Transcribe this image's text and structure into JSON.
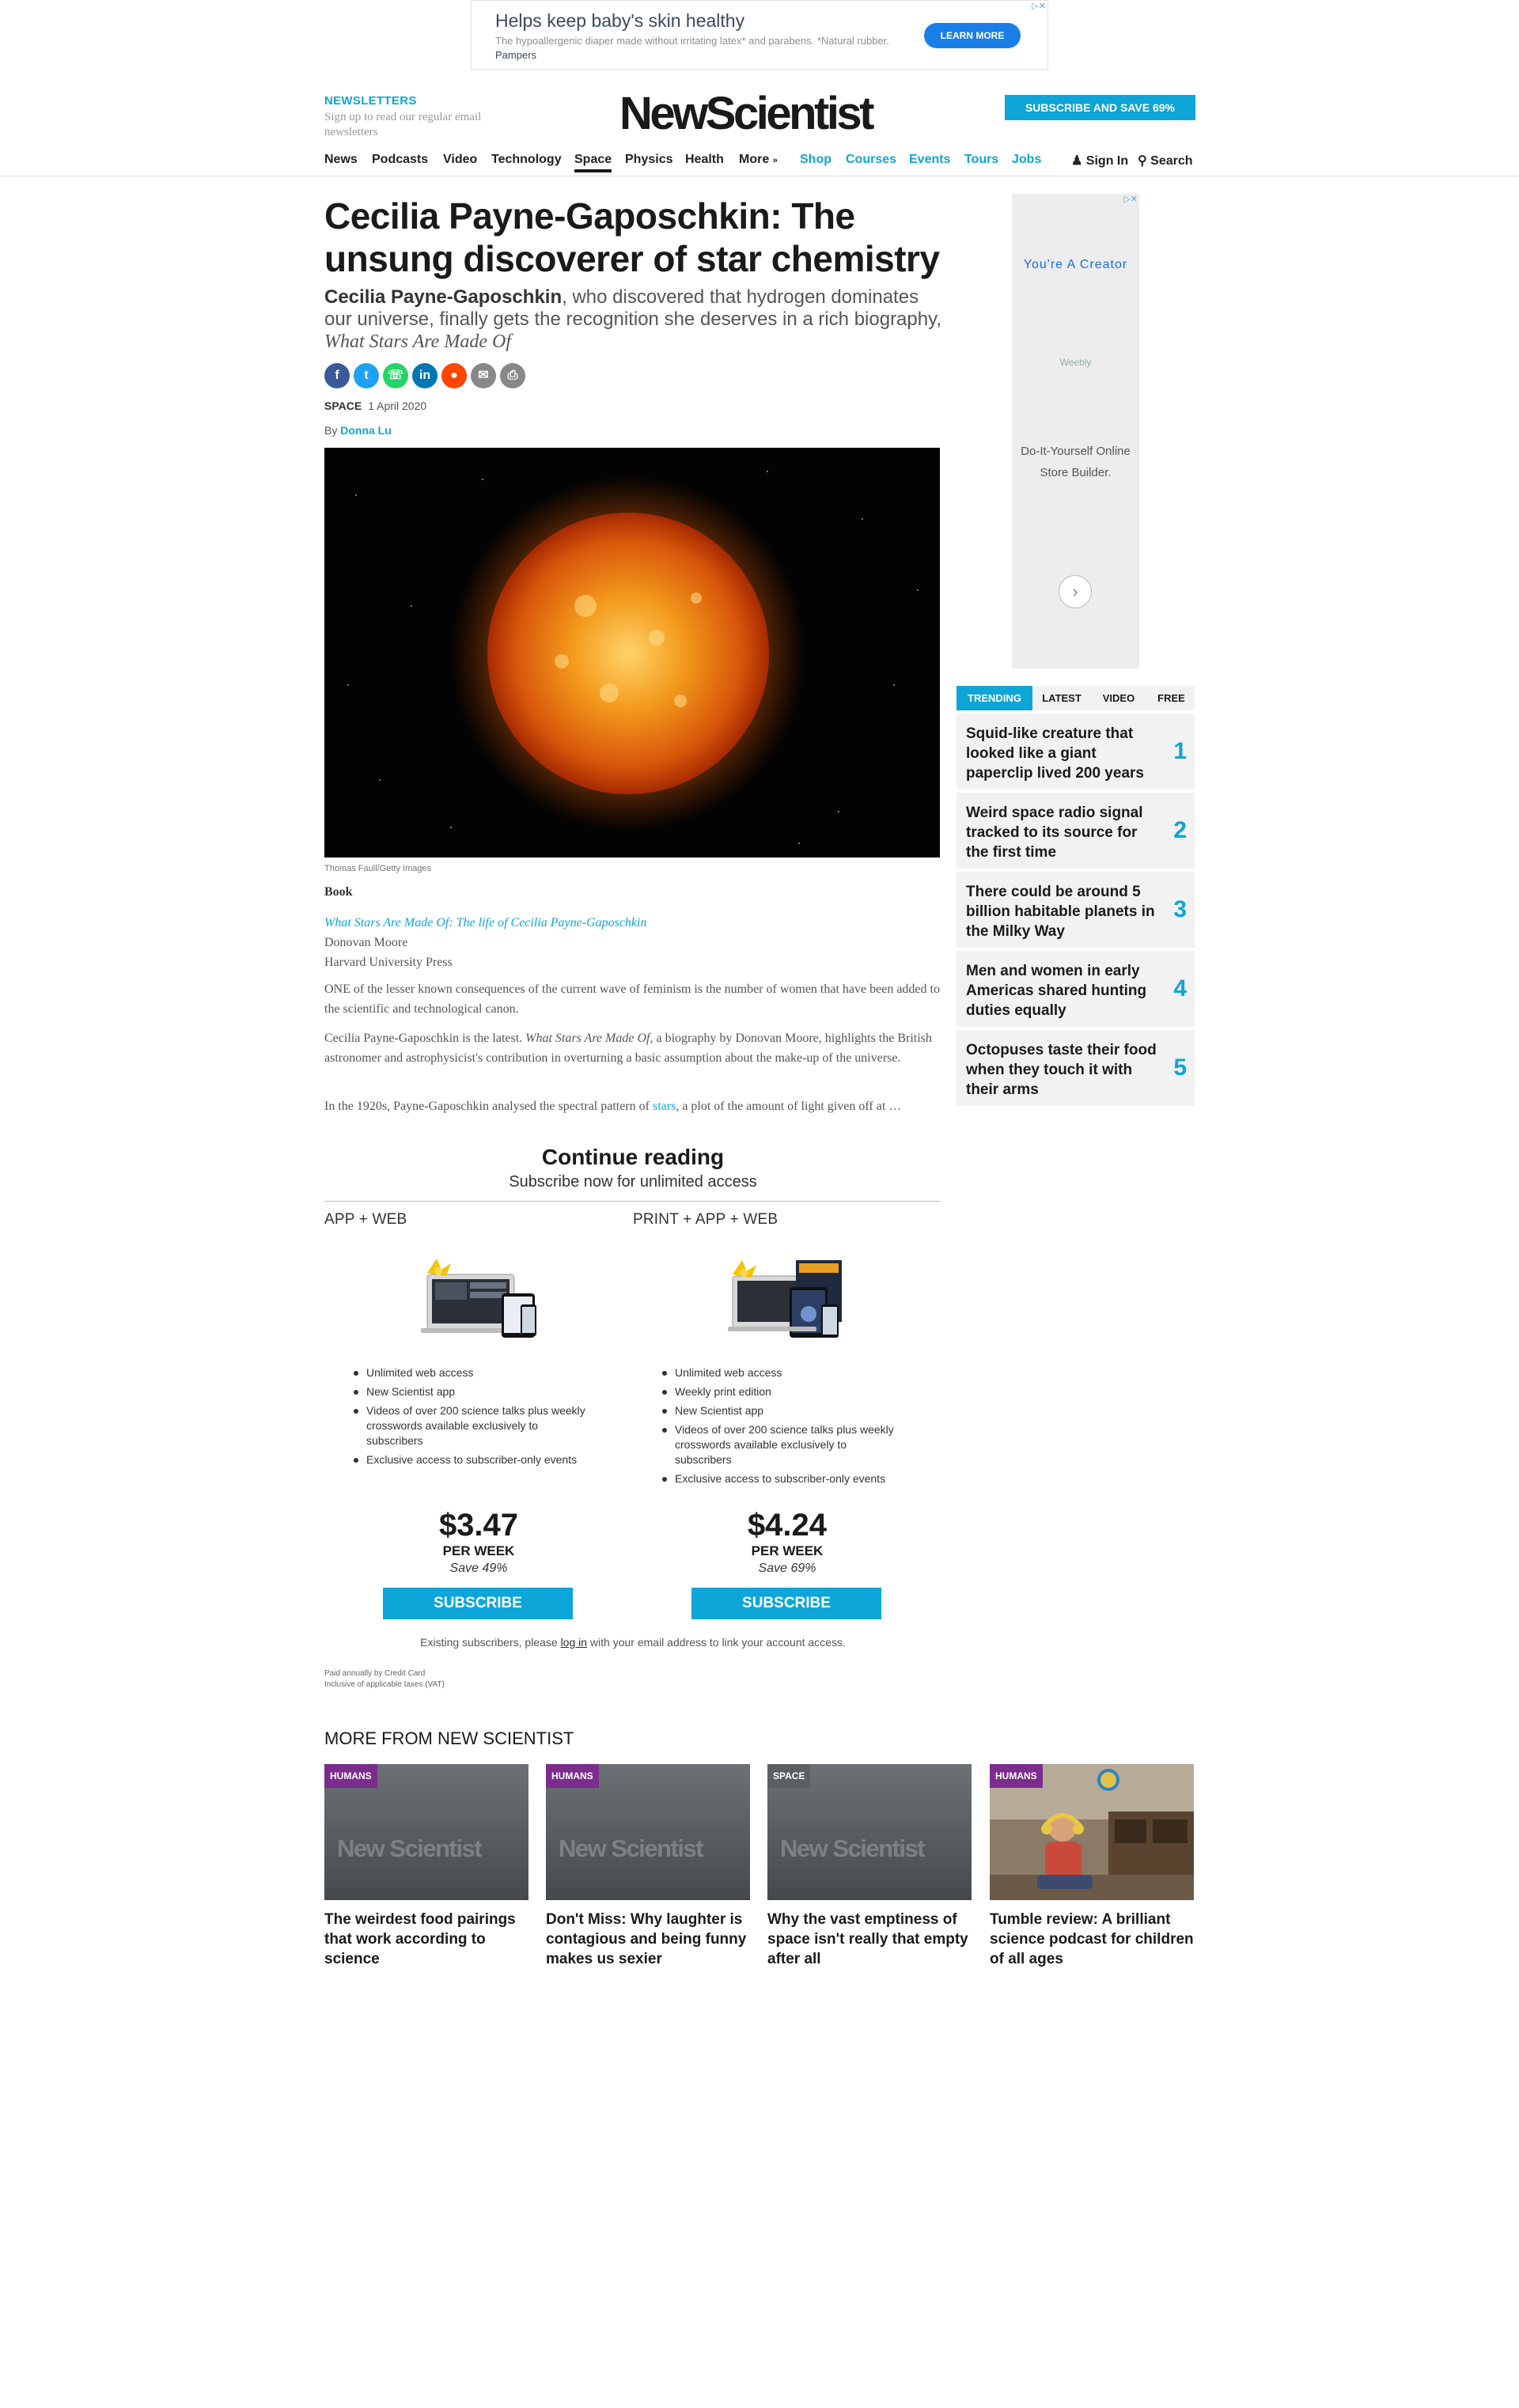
{
  "ad_top": {
    "headline": "Helps keep baby's skin healthy",
    "desc": "The hypoallergenic diaper made without irritating latex* and parabens. *Natural rubber.",
    "brand": "Pampers",
    "cta": "LEARN MORE",
    "adchoices": "▷✕"
  },
  "header": {
    "newsletters_title": "NEWSLETTERS",
    "newsletters_sub": "Sign up to read our regular email newsletters",
    "logo": "NewScientist",
    "subscribe": "SUBSCRIBE AND SAVE 69%"
  },
  "nav": {
    "items": [
      "News",
      "Podcasts",
      "Video",
      "Technology",
      "Space",
      "Physics",
      "Health",
      "More",
      "Shop",
      "Courses",
      "Events",
      "Tours",
      "Jobs"
    ],
    "active": "Space",
    "signin": "Sign In",
    "search": "Search"
  },
  "article": {
    "headline": "Cecilia Payne-Gaposchkin: The unsung discoverer of star chemistry",
    "standfirst_name": "Cecilia Payne-Gaposchkin",
    "standfirst_text": ", who discovered that hydrogen dominates our universe, finally gets the recognition she deserves in a rich biography, ",
    "standfirst_book": "What Stars Are Made Of",
    "share_icons": [
      "facebook-icon",
      "twitter-icon",
      "whatsapp-icon",
      "linkedin-icon",
      "reddit-icon",
      "email-icon",
      "print-icon"
    ],
    "section": "SPACE",
    "date": "1 April 2020",
    "by": "By",
    "author": "Donna Lu",
    "image_credit": "Thomas Faull/Getty Images",
    "book_label": "Book",
    "book_title": "What Stars Are Made Of: The life of Cecilia Payne-Gaposchkin",
    "book_author": "Donovan Moore",
    "book_publisher": "Harvard University Press",
    "p1": "ONE of the lesser known consequences of the current wave of feminism is the number of women that have been added to the scientific and technological canon.",
    "p2_a": "Cecilia Payne-Gaposchkin is the latest. ",
    "p2_i": "What Stars Are Made Of,",
    "p2_b": " a biography by Donovan Moore, highlights the British astronomer and astrophysicist's contribution in overturning a basic assumption about the make-up of the universe.",
    "p3_a": "In the 1920s, Payne-Gaposchkin analysed the spectral pattern of ",
    "p3_link": "stars",
    "p3_b": ", a plot of the amount of light given off at …"
  },
  "paywall": {
    "title": "Continue reading",
    "subtitle": "Subscribe now for unlimited access",
    "plans": [
      {
        "name": "APP + WEB",
        "features": [
          "Unlimited web access",
          "New Scientist app",
          "Videos of over 200 science talks plus weekly crosswords available exclusively to subscribers",
          "Exclusive access to subscriber-only events"
        ],
        "price": "$3.47",
        "per": "PER WEEK",
        "save": "Save 49%",
        "cta": "SUBSCRIBE"
      },
      {
        "name": "PRINT + APP + WEB",
        "features": [
          "Unlimited web access",
          "Weekly print edition",
          "New Scientist app",
          "Videos of over 200 science talks plus weekly crosswords available exclusively to subscribers",
          "Exclusive access to subscriber-only events"
        ],
        "price": "$4.24",
        "per": "PER WEEK",
        "save": "Save 69%",
        "cta": "SUBSCRIBE"
      }
    ],
    "existing_a": "Existing subscribers, please ",
    "existing_link": "log in",
    "existing_b": " with your email address to link your account access.",
    "paid_note": "Paid annually by Credit Card",
    "tax_note": "Inclusive of applicable taxes (VAT)"
  },
  "sidebar_ad": {
    "title": "You're A Creator",
    "brand": "Weebly",
    "desc": "Do-It-Yourself Online Store Builder.",
    "adchoices": "▷✕"
  },
  "trending": {
    "tabs": [
      "TRENDING",
      "LATEST",
      "VIDEO",
      "FREE"
    ],
    "items": [
      {
        "title": "Squid-like creature that looked like a giant paperclip lived 200 years",
        "num": "1"
      },
      {
        "title": "Weird space radio signal tracked to its source for the first time",
        "num": "2"
      },
      {
        "title": "There could be around 5 billion habitable planets in the Milky Way",
        "num": "3"
      },
      {
        "title": "Men and women in early Americas shared hunting duties equally",
        "num": "4"
      },
      {
        "title": "Octopuses taste their food when they touch it with their arms",
        "num": "5"
      }
    ]
  },
  "more_from": {
    "title": "MORE FROM NEW SCIENTIST",
    "placeholder_logo": "New Scientist",
    "cards": [
      {
        "category": "HUMANS",
        "title": "The weirdest food pairings that work according to science"
      },
      {
        "category": "HUMANS",
        "title": "Don't Miss: Why laughter is contagious and being funny makes us sexier"
      },
      {
        "category": "SPACE",
        "title": "Why the vast emptiness of space isn't really that empty after all"
      },
      {
        "category": "HUMANS",
        "title": "Tumble review: A brilliant science podcast for children of all ages"
      }
    ]
  },
  "colors": {
    "accent": "#0ea5d8",
    "humans": "#7b2d8e",
    "space": "#5b5f63"
  }
}
